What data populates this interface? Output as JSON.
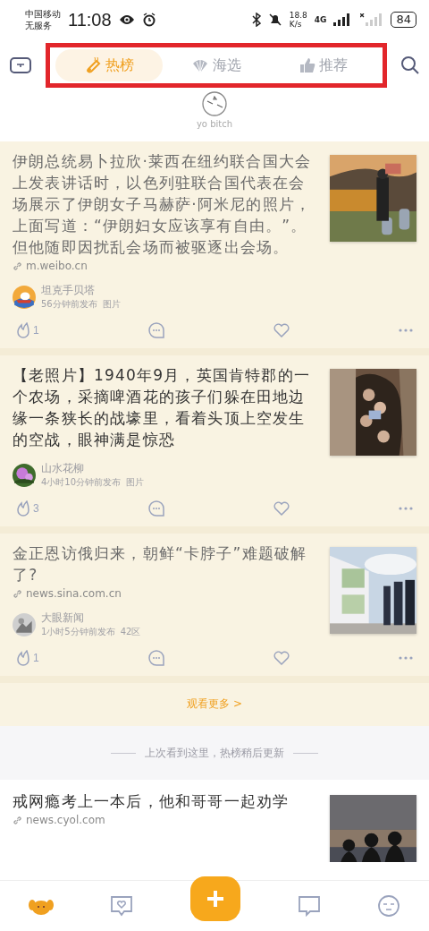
{
  "status_bar": {
    "carrier": "中国移动",
    "service": "无服务",
    "time": "11:08",
    "speed": "18.8",
    "speed_unit": "K/s",
    "network": "4G",
    "battery": "84"
  },
  "tabs_highlighted": true,
  "tabs": [
    {
      "label": "热榜",
      "selected": true
    },
    {
      "label": "海选",
      "selected": false
    },
    {
      "label": "推荐",
      "selected": false
    }
  ],
  "user": {
    "name": "yo bitch"
  },
  "cards": [
    {
      "title": "伊朗总统易卜拉欣·莱西在纽约联合国大会上发表讲话时，以色列驻联合国代表在会场展示了伊朗女子马赫萨·阿米尼的照片，上面写道：“伊朗妇女应该享有自由。”。但他随即因扰乱会场而被驱逐出会场。",
      "read": true,
      "source": "m.weibo.cn",
      "author": "坦克手贝塔",
      "time": "56分钟前发布",
      "tag": "图片",
      "likes": "1"
    },
    {
      "title": "【老照片】1940年9月，英国肯特郡的一个农场，采摘啤酒花的孩子们躲在田地边缘一条狭长的战壕里，看着头顶上空发生的空战，眼神满是惊恐",
      "read": false,
      "author": "山水花柳",
      "time": "4小时10分钟前发布",
      "tag": "图片",
      "likes": "3"
    },
    {
      "title": "金正恩访俄归来，朝鲜“卡脖子”难题破解了?",
      "read": true,
      "source": "news.sina.com.cn",
      "author": "大眼新闻",
      "time": "1小时5分钟前发布",
      "tag": "42区",
      "likes": "1"
    }
  ],
  "more_link": "观看更多 >",
  "divider_text": "上次看到这里，热榜稍后更新",
  "next_card": {
    "title": "戒网瘾考上一本后，他和哥哥一起劝学",
    "read": false,
    "source": "news.cyol.com"
  },
  "bottom_nav": [
    {
      "kind": "dog",
      "selected": true
    },
    {
      "kind": "heart-bubble",
      "selected": false
    },
    {
      "kind": "plus",
      "selected": false
    },
    {
      "kind": "chat",
      "selected": false
    },
    {
      "kind": "face",
      "selected": false
    }
  ]
}
